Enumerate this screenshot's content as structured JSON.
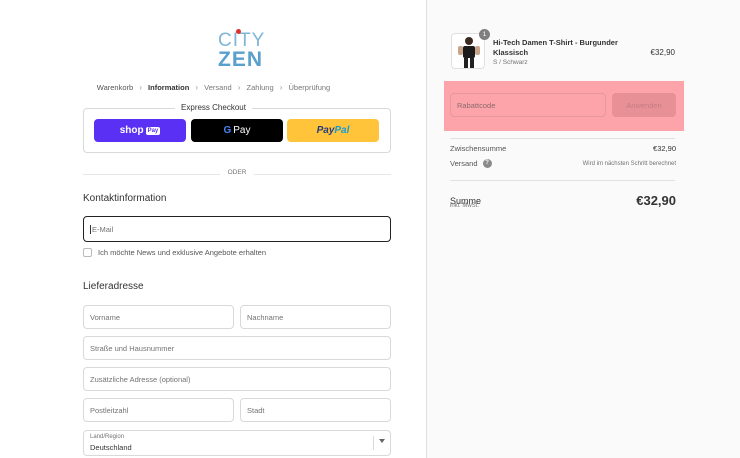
{
  "logo": {
    "line1": "CITY",
    "line2": "ZEN"
  },
  "breadcrumb": [
    "Warenkorb",
    "Information",
    "Versand",
    "Zahlung",
    "Überprüfung"
  ],
  "express": {
    "title": "Express Checkout",
    "shop_pay": "shop",
    "shop_pay_box": "Pay",
    "gpay_g": "G",
    "gpay_label": "Pay",
    "paypal1": "Pay",
    "paypal2": "Pal"
  },
  "divider": "ODER",
  "contact": {
    "heading": "Kontaktinformation",
    "email_placeholder": "E-Mail",
    "newsletter_label": "Ich möchte News und exklusive Angebote erhalten"
  },
  "shipping": {
    "heading": "Lieferadresse",
    "first_name": "Vorname",
    "last_name": "Nachname",
    "street": "Straße und Hausnummer",
    "address2": "Zusätzliche Adresse (optional)",
    "zip": "Postleitzahl",
    "city": "Stadt",
    "country_label": "Land/Region",
    "country_value": "Deutschland"
  },
  "summary": {
    "product": {
      "quantity": "1",
      "name": "Hi-Tech Damen T-Shirt - Burgunder Klassisch",
      "variant": "S / Schwarz",
      "price": "€32,90"
    },
    "discount_placeholder": "Rabattcode",
    "apply_label": "Anwenden",
    "subtotal_label": "Zwischensumme",
    "subtotal_value": "€32,90",
    "shipping_label": "Versand",
    "shipping_value": "Wird im nächsten Schritt berechnet",
    "total_label": "Summe",
    "tax_note": "inkl. MwSt.",
    "total_value": "€32,90"
  },
  "colors": {
    "shop_pay": "#5a31f4",
    "paypal": "#ffc439",
    "discount_highlight": "#fca4a9"
  }
}
